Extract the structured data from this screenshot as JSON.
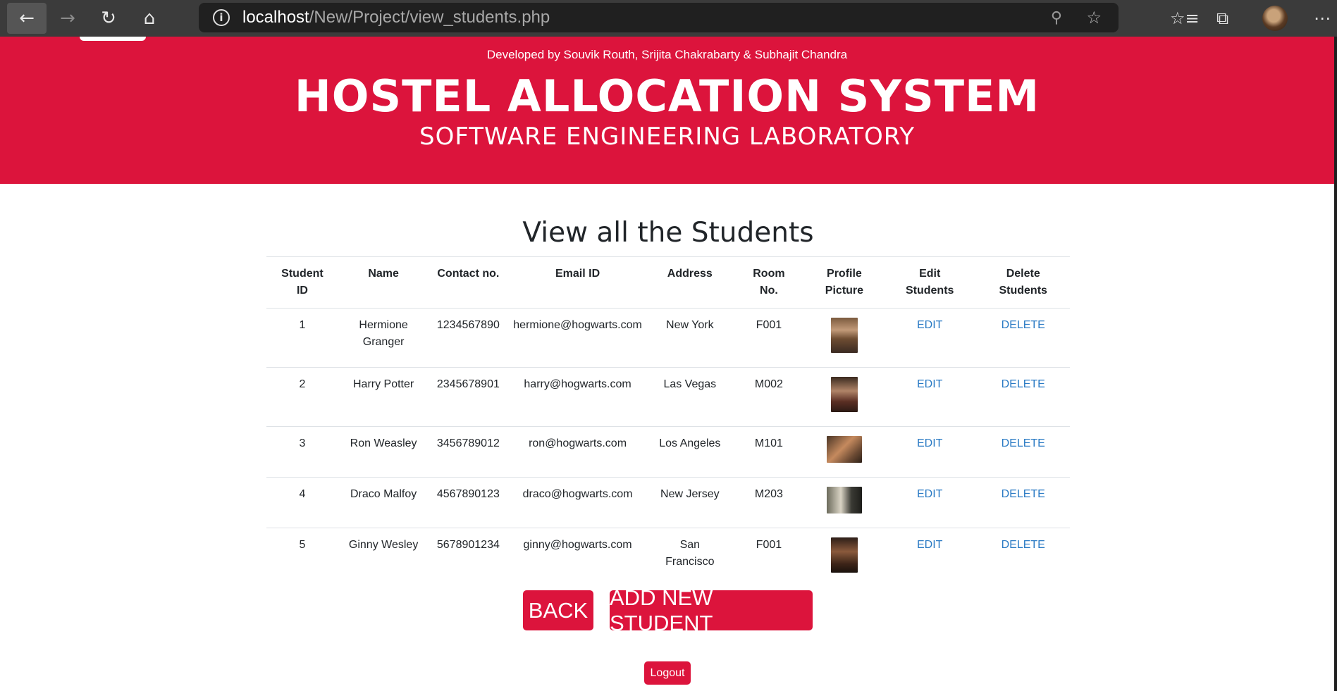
{
  "browser": {
    "url_host": "localhost",
    "url_path": "/New/Project/view_students.php"
  },
  "banner": {
    "credits": "Developed by Souvik Routh, Srijita Chakrabarty & Subhajit Chandra",
    "title": "HOSTEL ALLOCATION SYSTEM",
    "subtitle": "SOFTWARE ENGINEERING LABORATORY",
    "color": "#dc143c"
  },
  "page": {
    "heading": "View all the Students"
  },
  "table": {
    "headers": {
      "id_line1": "Student",
      "id_line2": "ID",
      "name": "Name",
      "contact": "Contact no.",
      "email": "Email ID",
      "address": "Address",
      "room_line1": "Room",
      "room_line2": "No.",
      "pic_line1": "Profile",
      "pic_line2": "Picture",
      "edit_line1": "Edit",
      "edit_line2": "Students",
      "delete_line1": "Delete",
      "delete_line2": "Students"
    },
    "rows": [
      {
        "id": "1",
        "name_line1": "Hermione",
        "name_line2": "Granger",
        "contact": "1234567890",
        "email": "hermione@hogwarts.com",
        "address_line1": "New York",
        "address_line2": "",
        "room": "F001",
        "edit": "EDIT",
        "delete": "DELETE"
      },
      {
        "id": "2",
        "name_line1": "Harry Potter",
        "name_line2": "",
        "contact": "2345678901",
        "email": "harry@hogwarts.com",
        "address_line1": "Las Vegas",
        "address_line2": "",
        "room": "M002",
        "edit": "EDIT",
        "delete": "DELETE"
      },
      {
        "id": "3",
        "name_line1": "Ron Weasley",
        "name_line2": "",
        "contact": "3456789012",
        "email": "ron@hogwarts.com",
        "address_line1": "Los Angeles",
        "address_line2": "",
        "room": "M101",
        "edit": "EDIT",
        "delete": "DELETE"
      },
      {
        "id": "4",
        "name_line1": "Draco Malfoy",
        "name_line2": "",
        "contact": "4567890123",
        "email": "draco@hogwarts.com",
        "address_line1": "New Jersey",
        "address_line2": "",
        "room": "M203",
        "edit": "EDIT",
        "delete": "DELETE"
      },
      {
        "id": "5",
        "name_line1": "Ginny Wesley",
        "name_line2": "",
        "contact": "5678901234",
        "email": "ginny@hogwarts.com",
        "address_line1": "San",
        "address_line2": "Francisco",
        "room": "F001",
        "edit": "EDIT",
        "delete": "DELETE"
      }
    ]
  },
  "actions": {
    "back": "BACK",
    "add_new": "ADD NEW STUDENT",
    "logout": "Logout"
  }
}
